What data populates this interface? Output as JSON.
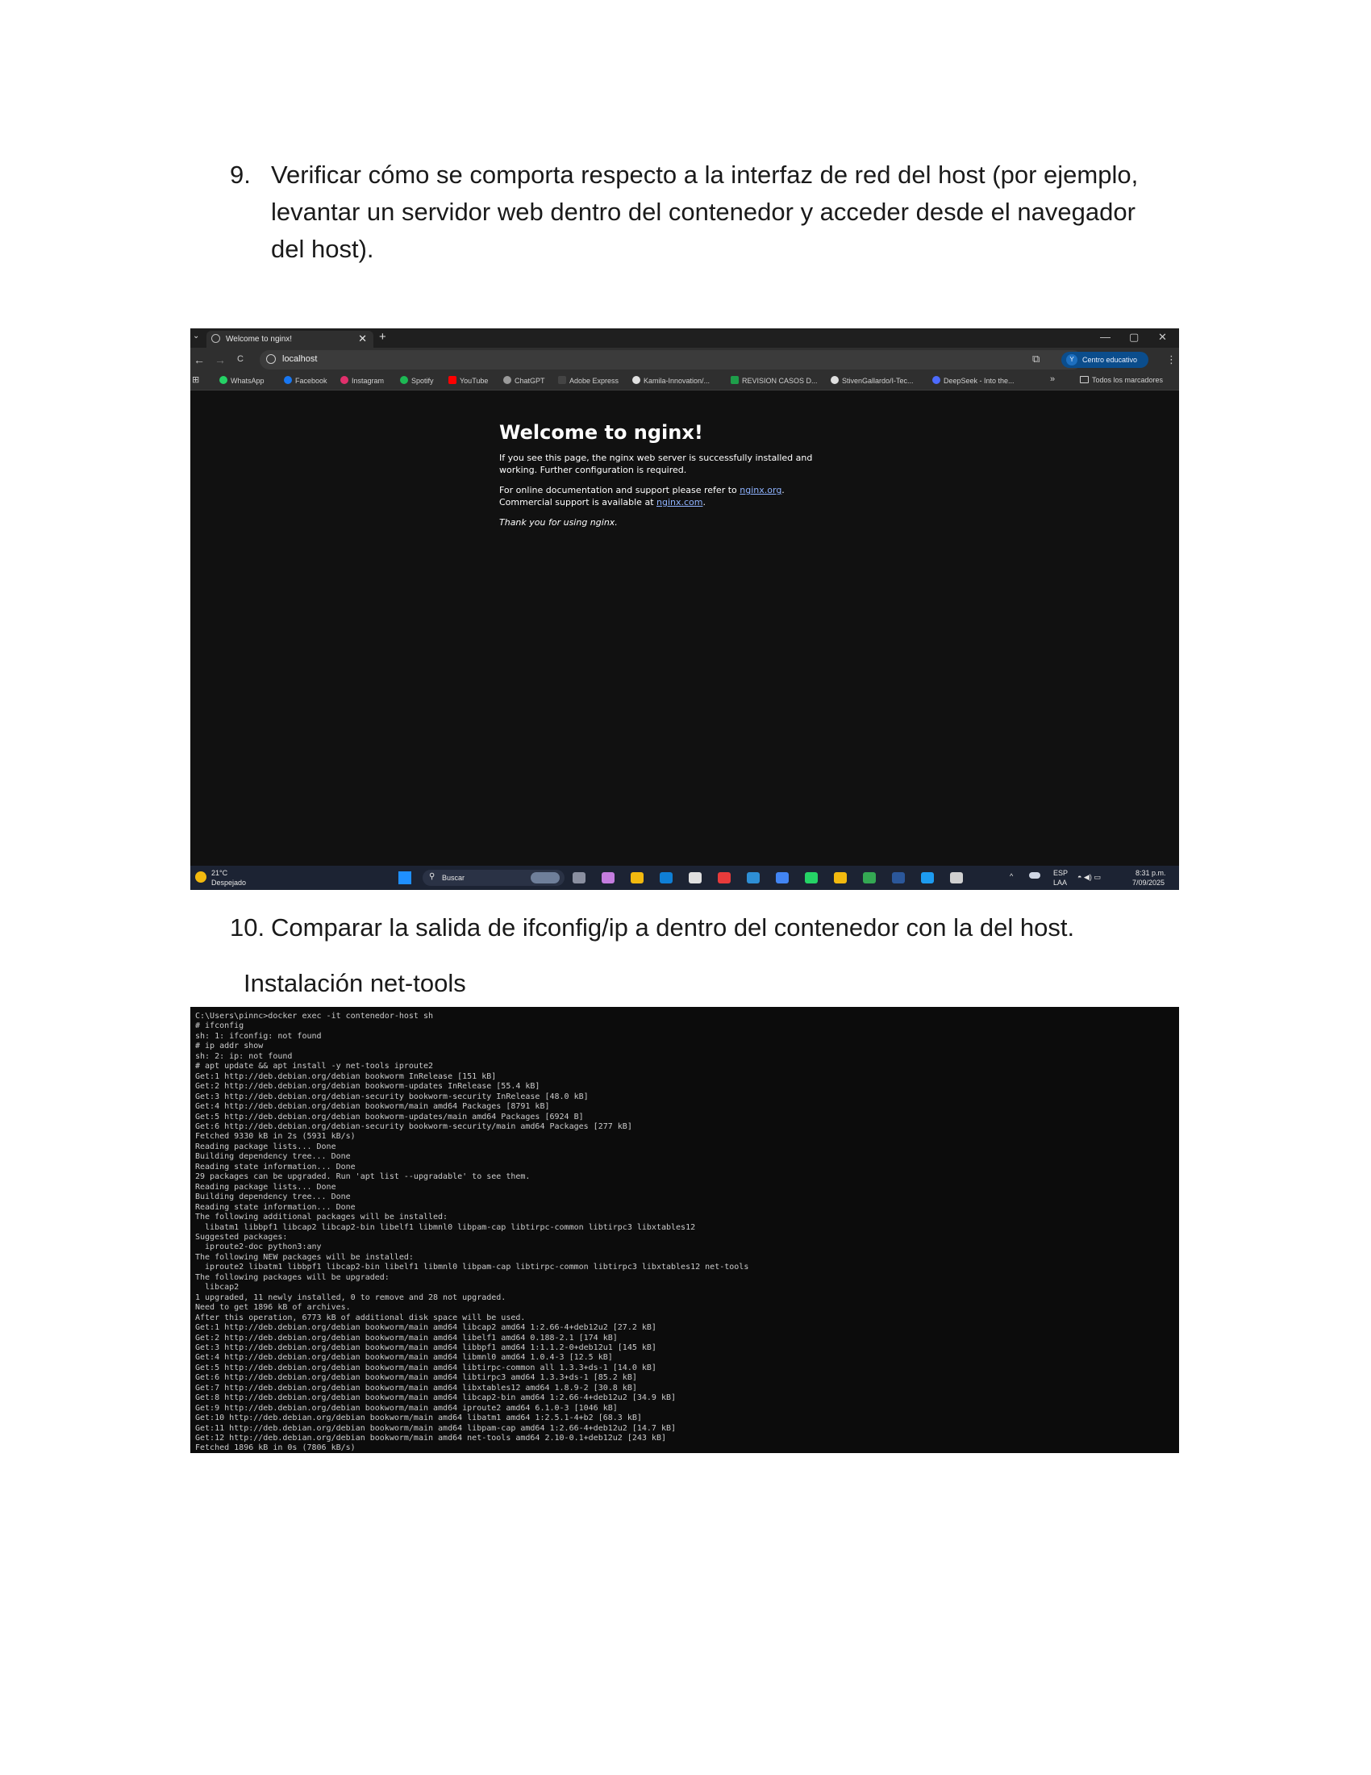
{
  "item9": {
    "number": "9.",
    "lines": [
      "Verificar cómo se comporta respecto a la interfaz de red del host (por ejemplo,",
      "levantar un servidor web dentro del contenedor y acceder desde el navegador",
      "del host)."
    ]
  },
  "browser": {
    "tab_title": "Welcome to nginx!",
    "tab_close": "✕",
    "new_tab": "+",
    "tab_list": "⌄",
    "window_controls": {
      "minimize": "—",
      "maximize": "▢",
      "close": "✕"
    },
    "nav": {
      "back": "←",
      "forward": "→",
      "reload": "C"
    },
    "url": "localhost",
    "star": "☆",
    "extensions": "⧉",
    "profile_initial": "Y",
    "profile_label": "Centro educativo",
    "menu": "⋮",
    "apps": "⊞",
    "bookmarks": [
      {
        "label": "WhatsApp",
        "color": "#25d366"
      },
      {
        "label": "Facebook",
        "color": "#1877f2"
      },
      {
        "label": "Instagram",
        "color": "#e1306c"
      },
      {
        "label": "Spotify",
        "color": "#1db954"
      },
      {
        "label": "YouTube",
        "color": "#ff0000"
      },
      {
        "label": "ChatGPT",
        "color": "#9a9a9a"
      },
      {
        "label": "Adobe Express",
        "color": "#222222"
      },
      {
        "label": "Kamila-Innovation/...",
        "color": "#e0e0e0"
      },
      {
        "label": "REVISION CASOS D...",
        "color": "#1e9e4a"
      },
      {
        "label": "StivenGallardo/I-Tec...",
        "color": "#e0e0e0"
      },
      {
        "label": "DeepSeek - Into the...",
        "color": "#4d6bfe"
      }
    ],
    "bookmarks_more": "»",
    "all_bookmarks": "Todos los marcadores",
    "page": {
      "heading": "Welcome to nginx!",
      "p1": "If you see this page, the nginx web server is successfully installed and",
      "p1b": "working. Further configuration is required.",
      "p2a": "For online documentation and support please refer to ",
      "link1": "nginx.org",
      "p2b": ".",
      "p3a": "Commercial support is available at ",
      "link2": "nginx.com",
      "p3b": ".",
      "p4": "Thank you for using nginx."
    },
    "taskbar": {
      "temp": "21°C",
      "weather": "Despejado",
      "search": "Buscar",
      "lang_top": "ESP",
      "lang_bottom": "LAA",
      "time": "8:31 p.m.",
      "date": "7/09/2025",
      "tray_up": "^",
      "tray_icons": "◓ ◀) ▭",
      "icon_colors": [
        "#8a8fa0",
        "#c47ddf",
        "#f2b90f",
        "#0f7fd6",
        "#e0e0e0",
        "#e83b3b",
        "#2e8fd6",
        "#4285f4",
        "#25d366",
        "#f2b90f",
        "#34a853",
        "#2b579a",
        "#1d9bf0",
        "#d0d0d0"
      ]
    }
  },
  "item10": {
    "number": "10.",
    "text": "Comparar la salida de ifconfig/ip a dentro del contenedor con la del host."
  },
  "subheading": "Instalación net-tools",
  "terminal": {
    "lines": [
      "C:\\Users\\pinnc>docker exec -it contenedor-host sh",
      "# ifconfig",
      "sh: 1: ifconfig: not found",
      "# ip addr show",
      "sh: 2: ip: not found",
      "# apt update && apt install -y net-tools iproute2",
      "Get:1 http://deb.debian.org/debian bookworm InRelease [151 kB]",
      "Get:2 http://deb.debian.org/debian bookworm-updates InRelease [55.4 kB]",
      "Get:3 http://deb.debian.org/debian-security bookworm-security InRelease [48.0 kB]",
      "Get:4 http://deb.debian.org/debian bookworm/main amd64 Packages [8791 kB]",
      "Get:5 http://deb.debian.org/debian bookworm-updates/main amd64 Packages [6924 B]",
      "Get:6 http://deb.debian.org/debian-security bookworm-security/main amd64 Packages [277 kB]",
      "Fetched 9330 kB in 2s (5931 kB/s)",
      "Reading package lists... Done",
      "Building dependency tree... Done",
      "Reading state information... Done",
      "29 packages can be upgraded. Run 'apt list --upgradable' to see them.",
      "Reading package lists... Done",
      "Building dependency tree... Done",
      "Reading state information... Done",
      "The following additional packages will be installed:",
      "  libatm1 libbpf1 libcap2 libcap2-bin libelf1 libmnl0 libpam-cap libtirpc-common libtirpc3 libxtables12",
      "Suggested packages:",
      "  iproute2-doc python3:any",
      "The following NEW packages will be installed:",
      "  iproute2 libatm1 libbpf1 libcap2-bin libelf1 libmnl0 libpam-cap libtirpc-common libtirpc3 libxtables12 net-tools",
      "The following packages will be upgraded:",
      "  libcap2",
      "1 upgraded, 11 newly installed, 0 to remove and 28 not upgraded.",
      "Need to get 1896 kB of archives.",
      "After this operation, 6773 kB of additional disk space will be used.",
      "Get:1 http://deb.debian.org/debian bookworm/main amd64 libcap2 amd64 1:2.66-4+deb12u2 [27.2 kB]",
      "Get:2 http://deb.debian.org/debian bookworm/main amd64 libelf1 amd64 0.188-2.1 [174 kB]",
      "Get:3 http://deb.debian.org/debian bookworm/main amd64 libbpf1 amd64 1:1.1.2-0+deb12u1 [145 kB]",
      "Get:4 http://deb.debian.org/debian bookworm/main amd64 libmnl0 amd64 1.0.4-3 [12.5 kB]",
      "Get:5 http://deb.debian.org/debian bookworm/main amd64 libtirpc-common all 1.3.3+ds-1 [14.0 kB]",
      "Get:6 http://deb.debian.org/debian bookworm/main amd64 libtirpc3 amd64 1.3.3+ds-1 [85.2 kB]",
      "Get:7 http://deb.debian.org/debian bookworm/main amd64 libxtables12 amd64 1.8.9-2 [30.8 kB]",
      "Get:8 http://deb.debian.org/debian bookworm/main amd64 libcap2-bin amd64 1:2.66-4+deb12u2 [34.9 kB]",
      "Get:9 http://deb.debian.org/debian bookworm/main amd64 iproute2 amd64 6.1.0-3 [1046 kB]",
      "Get:10 http://deb.debian.org/debian bookworm/main amd64 libatm1 amd64 1:2.5.1-4+b2 [68.3 kB]",
      "Get:11 http://deb.debian.org/debian bookworm/main amd64 libpam-cap amd64 1:2.66-4+deb12u2 [14.7 kB]",
      "Get:12 http://deb.debian.org/debian bookworm/main amd64 net-tools amd64 2.10-0.1+deb12u2 [243 kB]",
      "Fetched 1896 kB in 0s (7806 kB/s)"
    ]
  }
}
